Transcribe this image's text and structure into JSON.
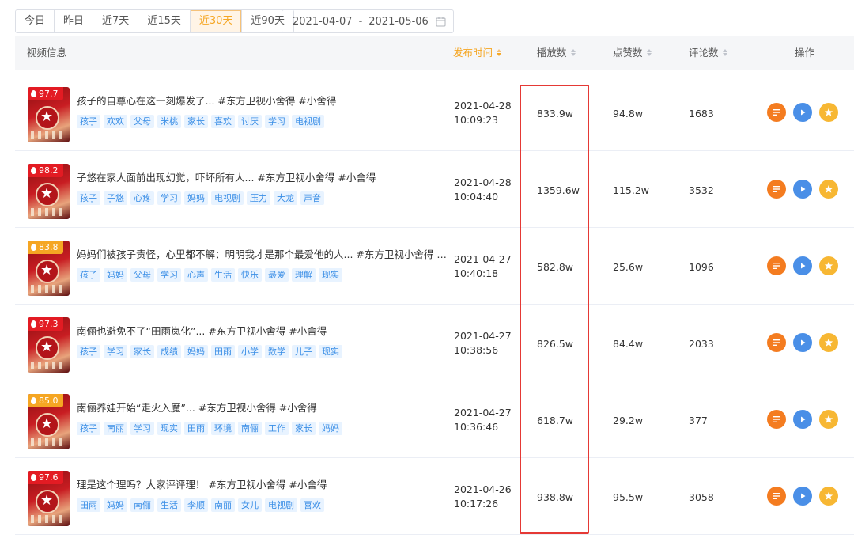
{
  "filters": {
    "tabs": [
      {
        "label": "今日",
        "active": false
      },
      {
        "label": "昨日",
        "active": false
      },
      {
        "label": "近7天",
        "active": false
      },
      {
        "label": "近15天",
        "active": false
      },
      {
        "label": "近30天",
        "active": true
      },
      {
        "label": "近90天",
        "active": false
      }
    ],
    "date_start": "2021-04-07",
    "date_sep": "-",
    "date_end": "2021-05-06",
    "calendar_icon": "calendar-icon"
  },
  "table": {
    "columns": {
      "video": "视频信息",
      "publish_time": "发布时间",
      "plays": "播放数",
      "likes": "点赞数",
      "comments": "评论数",
      "actions": "操作"
    },
    "rows": [
      {
        "score": "97.7",
        "badge_color": "#e31b23",
        "title": "孩子的自尊心在这一刻爆发了... #东方卫视小舍得 #小舍得",
        "tags": [
          "孩子",
          "欢欢",
          "父母",
          "米桃",
          "家长",
          "喜欢",
          "讨厌",
          "学习",
          "电视剧"
        ],
        "date": "2021-04-28",
        "time": "10:09:23",
        "plays": "833.9w",
        "likes": "94.8w",
        "comments": "1683"
      },
      {
        "score": "98.2",
        "badge_color": "#e31b23",
        "title": "子悠在家人面前出现幻觉，吓坏所有人... #东方卫视小舍得 #小舍得",
        "tags": [
          "孩子",
          "子悠",
          "心疼",
          "学习",
          "妈妈",
          "电视剧",
          "压力",
          "大龙",
          "声音"
        ],
        "date": "2021-04-28",
        "time": "10:04:40",
        "plays": "1359.6w",
        "likes": "115.2w",
        "comments": "3532"
      },
      {
        "score": "83.8",
        "badge_color": "#f5a623",
        "title": "妈妈们被孩子责怪，心里都不解：明明我才是那个最爱他的人... #东方卫视小舍得 #...",
        "tags": [
          "孩子",
          "妈妈",
          "父母",
          "学习",
          "心声",
          "生活",
          "快乐",
          "最爱",
          "理解",
          "现实"
        ],
        "date": "2021-04-27",
        "time": "10:40:18",
        "plays": "582.8w",
        "likes": "25.6w",
        "comments": "1096"
      },
      {
        "score": "97.3",
        "badge_color": "#e31b23",
        "title": "南俪也避免不了“田雨岚化”... #东方卫视小舍得 #小舍得",
        "tags": [
          "孩子",
          "学习",
          "家长",
          "成绩",
          "妈妈",
          "田雨",
          "小学",
          "数学",
          "儿子",
          "现实"
        ],
        "date": "2021-04-27",
        "time": "10:38:56",
        "plays": "826.5w",
        "likes": "84.4w",
        "comments": "2033"
      },
      {
        "score": "85.0",
        "badge_color": "#f5a623",
        "title": "南俪养娃开始“走火入魔”... #东方卫视小舍得 #小舍得",
        "tags": [
          "孩子",
          "南丽",
          "学习",
          "现实",
          "田雨",
          "环境",
          "南俪",
          "工作",
          "家长",
          "妈妈"
        ],
        "date": "2021-04-27",
        "time": "10:36:46",
        "plays": "618.7w",
        "likes": "29.2w",
        "comments": "377"
      },
      {
        "score": "97.6",
        "badge_color": "#e31b23",
        "title": "理是这个理吗？大家评评理！ #东方卫视小舍得 #小舍得",
        "tags": [
          "田雨",
          "妈妈",
          "南俪",
          "生活",
          "李顺",
          "南丽",
          "女儿",
          "电视剧",
          "喜欢"
        ],
        "date": "2021-04-26",
        "time": "10:17:26",
        "plays": "938.8w",
        "likes": "95.5w",
        "comments": "3058"
      }
    ]
  },
  "icons": {
    "list": "list-icon",
    "play": "play-icon",
    "fav": "star-icon"
  }
}
